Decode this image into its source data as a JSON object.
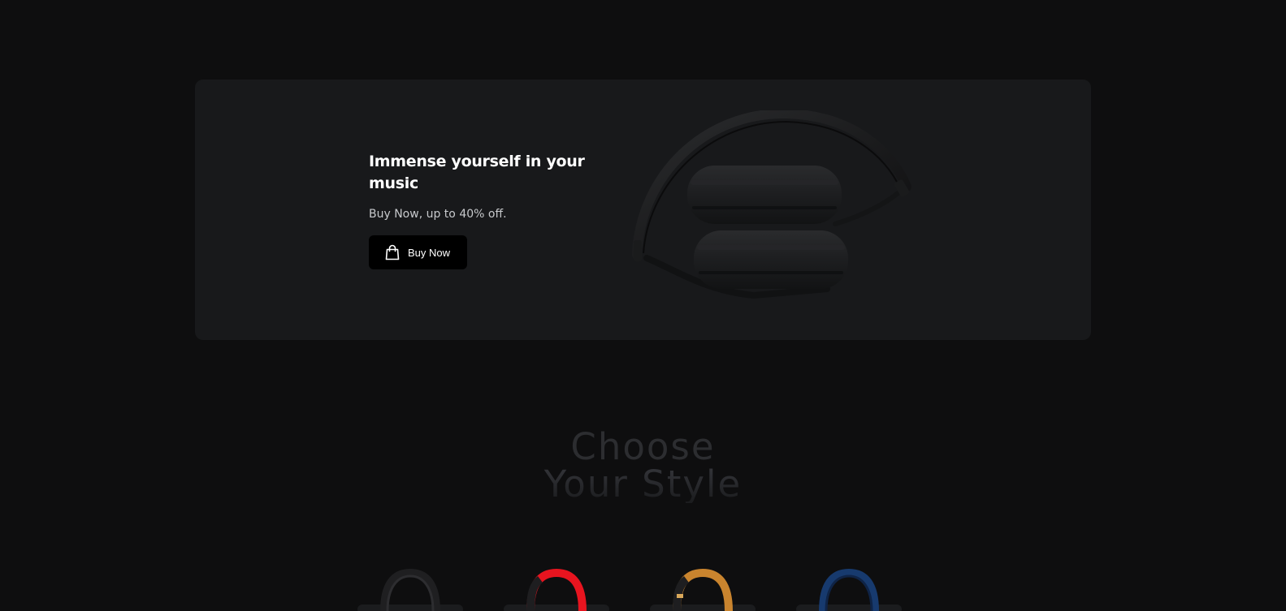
{
  "hero": {
    "title": "Immense yourself in your music",
    "subtitle": "Buy Now, up to 40% off.",
    "buy_button_label": "Buy Now",
    "button_icon": "shopping-bag-icon"
  },
  "section": {
    "heading_line1": "Choose",
    "heading_line2": "Your Style"
  },
  "styles": [
    {
      "color": "#1c1c1e",
      "accent": "#2a2a2c"
    },
    {
      "color": "#e8141f",
      "accent": "#1e1e20"
    },
    {
      "color": "#c9842e",
      "accent": "#1e1e20"
    },
    {
      "color": "#173a6e",
      "accent": "#0f2447"
    }
  ],
  "colors": {
    "background": "#0e0e0f",
    "card": "#18191b",
    "button": "#000000"
  }
}
